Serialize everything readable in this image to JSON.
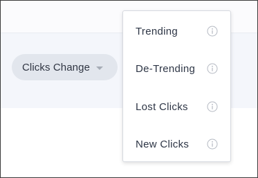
{
  "filter": {
    "label": "Clicks Change",
    "caret_icon": "caret-down-icon"
  },
  "menu": {
    "items": [
      {
        "label": "Trending",
        "icon": "info-icon"
      },
      {
        "label": "De-Trending",
        "icon": "info-icon"
      },
      {
        "label": "Lost Clicks",
        "icon": "info-icon"
      },
      {
        "label": "New Clicks",
        "icon": "info-icon"
      }
    ]
  },
  "colors": {
    "filter_band": "#f4f6fb",
    "pill_background": "#e2e6ed",
    "text": "#2d3545",
    "icon_gray": "#b3b8c1"
  }
}
